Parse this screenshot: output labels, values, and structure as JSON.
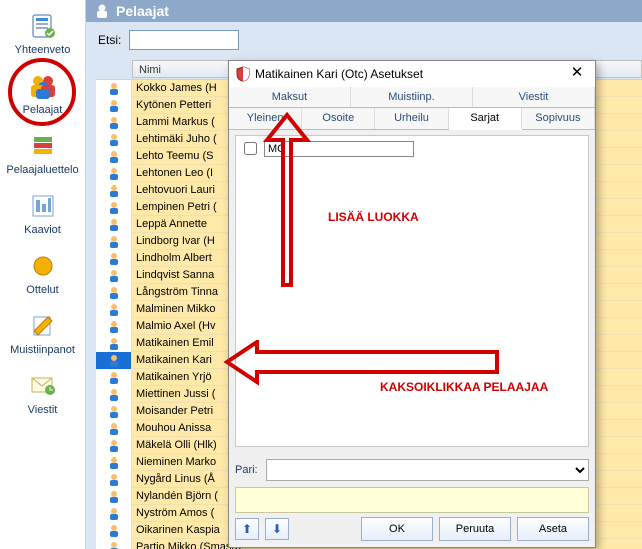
{
  "sidebar": {
    "items": [
      {
        "label": "Yhteenveto"
      },
      {
        "label": "Pelaajat"
      },
      {
        "label": "Pelaajaluettelo"
      },
      {
        "label": "Kaaviot"
      },
      {
        "label": "Ottelut"
      },
      {
        "label": "Muistiinpanot"
      },
      {
        "label": "Viestit"
      }
    ]
  },
  "header": {
    "title": "Pelaajat",
    "search_label": "Etsi:",
    "search_value": ""
  },
  "list": {
    "column": "Nimi",
    "selected_index": 12,
    "rows": [
      "Kokko James (H",
      "Kytönen Petteri",
      "Lammi Markus (",
      "Lehtimäki Juho (",
      "Lehto Teemu (S",
      "Lehtonen Leo (I",
      "Lehtovuori Lauri",
      "Lempinen Petri (",
      "Leppä Annette",
      "Lindborg Ivar (H",
      "Lindholm Albert",
      "Lindqvist Sanna",
      "Långström Tinna",
      "Malminen Mikko",
      "Malmio Axel (Hv",
      "Matikainen Emil",
      "Matikainen Kari",
      "Matikainen Yrjö",
      "Miettinen Jussi (",
      "Moisander Petri",
      "Mouhou Anissa",
      "Mäkelä Olli (Hlk)",
      "Nieminen Marko",
      "Nygård Linus (Å",
      "Nylandén Björn (",
      "Nyström Amos (",
      "Oikarinen Kaspia",
      "Partio Mikko (Smash)"
    ]
  },
  "dialog": {
    "title": "Matikainen Kari (Otc) Asetukset",
    "tabs_top": [
      "Maksut",
      "Muistiinp.",
      "Viestit"
    ],
    "tabs_bottom": [
      "Yleinen",
      "Osoite",
      "Urheilu",
      "Sarjat",
      "Sopivuus"
    ],
    "active_tab": "Sarjat",
    "class_value": "MC",
    "pair_label": "Pari:",
    "pair_value": "",
    "buttons": {
      "ok": "OK",
      "cancel": "Peruuta",
      "set": "Aseta"
    }
  },
  "annotations": {
    "add_class": "LISÄÄ LUOKKA",
    "dblclick": "KAKSOIKLIKKAA PELAAJAA"
  }
}
